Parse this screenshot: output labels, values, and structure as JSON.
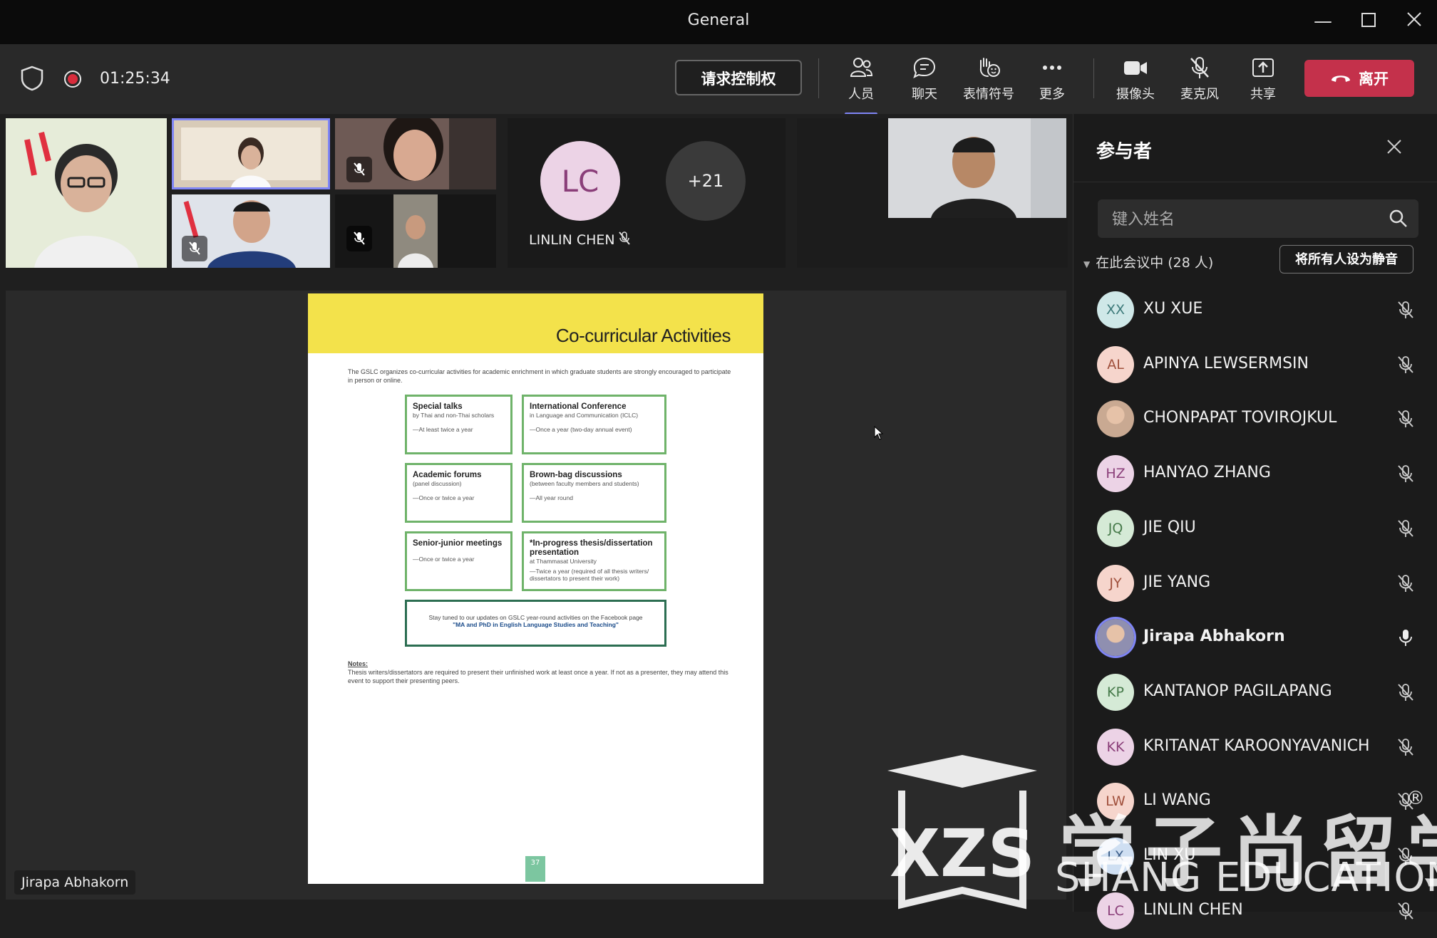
{
  "window": {
    "title": "General"
  },
  "toolbar": {
    "timer": "01:25:34",
    "request_control": "请求控制权",
    "people": "人员",
    "chat": "聊天",
    "reactions": "表情符号",
    "more": "更多",
    "camera": "摄像头",
    "mic": "麦克风",
    "share": "共享",
    "leave": "离开"
  },
  "stage": {
    "tile_initials": "LC",
    "tile_name": "LINLIN CHEN",
    "overflow_count": "+21",
    "speaker_label": "Jirapa Abhakorn"
  },
  "slide": {
    "title": "Co-curricular Activities",
    "intro": "The GSLC organizes co-curricular activities for academic enrichment in which graduate students are strongly encouraged to participate in person or online.",
    "activities": [
      {
        "heading": "Special talks",
        "sub": "by Thai and non-Thai scholars",
        "freq": "—At least twice a year"
      },
      {
        "heading": "International Conference",
        "sub": "in Language and Communication (ICLC)",
        "freq": "—Once a year (two-day annual event)"
      },
      {
        "heading": "Academic forums",
        "sub": "(panel discussion)",
        "freq": "—Once or twice a year"
      },
      {
        "heading": "Brown-bag discussions",
        "sub": "(between faculty members and students)",
        "freq": "—All year round"
      },
      {
        "heading": "Senior-junior meetings",
        "sub": "",
        "freq": "—Once or twice a year"
      },
      {
        "heading": "*In-progress thesis/dissertation presentation",
        "sub": "at Thammasat University",
        "freq": "—Twice a year (required of all thesis writers/ dissertators to present their work)"
      }
    ],
    "stay_tuned": "Stay tuned to our updates on GSLC year-round activities on the Facebook page",
    "facebook_page": "\"MA and PhD in English Language Studies and Teaching\"",
    "notes_label": "Notes:",
    "notes_text": "Thesis writers/dissertators are required to present their unfinished work at least once a year. If not as a presenter, they may attend this event to support their presenting peers.",
    "page_number": "37"
  },
  "panel": {
    "title": "参与者",
    "search_placeholder": "键入姓名",
    "in_meeting": "在此会议中 (28 人)",
    "mute_all": "将所有人设为静音",
    "participants": [
      {
        "initials": "XX",
        "name": "XU XUE",
        "color": "#cfe8e8",
        "fg": "#3d7a7a",
        "muted": true
      },
      {
        "initials": "AL",
        "name": "APINYA LEWSERMSIN",
        "color": "#f6d5cc",
        "fg": "#a0503c",
        "muted": true
      },
      {
        "initials": "",
        "name": "CHONPAPAT TOVIROJKUL",
        "color": "#c9a992",
        "fg": "#fff",
        "muted": true
      },
      {
        "initials": "HZ",
        "name": "HANYAO ZHANG",
        "color": "#ecd3e6",
        "fg": "#8a3e79",
        "muted": true
      },
      {
        "initials": "JQ",
        "name": "JIE QIU",
        "color": "#d5ead6",
        "fg": "#467a4a",
        "muted": true
      },
      {
        "initials": "JY",
        "name": "JIE YANG",
        "color": "#f6d5cc",
        "fg": "#a0503c",
        "muted": true
      },
      {
        "initials": "",
        "name": "Jirapa Abhakorn",
        "color": "#8f8fb0",
        "fg": "#fff",
        "muted": false
      },
      {
        "initials": "KP",
        "name": "KANTANOP PAGILAPANG",
        "color": "#d5ead6",
        "fg": "#467a4a",
        "muted": true
      },
      {
        "initials": "KK",
        "name": "KRITANAT KAROONYAVANICH",
        "color": "#ecd3e6",
        "fg": "#8a3e79",
        "muted": true
      },
      {
        "initials": "LW",
        "name": "LI WANG",
        "color": "#f6d5cc",
        "fg": "#a0503c",
        "muted": true
      },
      {
        "initials": "LX",
        "name": "LIN XU",
        "color": "#cfdff2",
        "fg": "#3d5f8a",
        "muted": true
      },
      {
        "initials": "LC",
        "name": "LINLIN CHEN",
        "color": "#ecd3e6",
        "fg": "#8a3e79",
        "muted": true
      }
    ]
  },
  "watermark": {
    "cn": "学子尚留学",
    "en": "SHANG EDUCATION",
    "logo": "XZS",
    "reg": "®"
  }
}
